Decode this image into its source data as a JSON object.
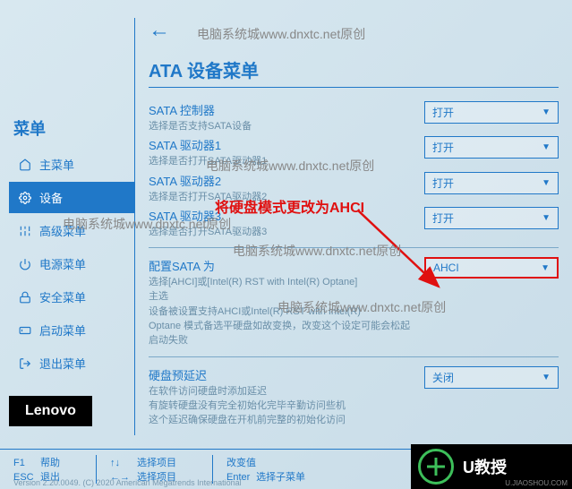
{
  "watermarks": {
    "top": "电脑系统城www.dnxtc.net原创",
    "mid1": "电脑系统城www.dnxtc.net原创",
    "mid2": "电脑系统城www.dnxtc.net原创",
    "mid3": "电脑系统城www.dnxtc.net原创",
    "mid4": "电脑系统城www.dnxtc.net原创"
  },
  "sidebar": {
    "title": "菜单",
    "items": [
      {
        "icon": "home",
        "label": "主菜单"
      },
      {
        "icon": "gear",
        "label": "设备"
      },
      {
        "icon": "sliders",
        "label": "高级菜单"
      },
      {
        "icon": "power",
        "label": "电源菜单"
      },
      {
        "icon": "lock",
        "label": "安全菜单"
      },
      {
        "icon": "boot",
        "label": "启动菜单"
      },
      {
        "icon": "exit",
        "label": "退出菜单"
      }
    ]
  },
  "page": {
    "title": "ATA 设备菜单"
  },
  "settings": [
    {
      "label": "SATA 控制器",
      "desc": "选择是否支持SATA设备",
      "value": "打开"
    },
    {
      "label": "SATA 驱动器1",
      "desc": "选择是否打开SATA驱动器1",
      "value": "打开"
    },
    {
      "label": "SATA 驱动器2",
      "desc": "选择是否打开SATA驱动器2",
      "value": "打开"
    },
    {
      "label": "SATA 驱动器3",
      "desc": "选择是否打开SATA驱动器3",
      "value": "打开"
    }
  ],
  "sata_config": {
    "label": "配置SATA 为",
    "desc1": "选择[AHCI]或[Intel(R) RST with Intel(R) Optane]",
    "desc2": "主选",
    "desc3": "设备被设置支持AHCI或Intel(R) RST with Intel(R)",
    "desc4": "Optane 模式备选平硬盘如故变换，改变这个设定可能会松起",
    "desc5": "启动失败",
    "value": "AHCI"
  },
  "hdd_delay": {
    "label": "硬盘预延迟",
    "desc1": "在软件访问硬盘时添加延迟",
    "desc2": "有旋转硬盘没有完全初始化完毕辛勤访问些机",
    "desc3": "这个延迟确保硬盘在开机前完整的初始化访问",
    "value": "关闭"
  },
  "annotation": {
    "text": "将硬盘模式更改为AHCI"
  },
  "brand": "Lenovo",
  "footer": {
    "f1_key": "F1",
    "f1_label": "帮助",
    "esc_key": "ESC",
    "esc_label": "退出",
    "arrows_key": "↑↓",
    "arrows_label": "选择项目",
    "lr_key": "←→",
    "lr_label": "选择项目",
    "plus_key": "",
    "plus_label": "改变值",
    "enter_key": "Enter",
    "enter_label": "选择子菜单"
  },
  "version": "Version 2.20.0049. (C) 2020 American Megatrends International",
  "corner": {
    "text": "U教授",
    "sub": "U.JIAOSHOU.COM"
  }
}
